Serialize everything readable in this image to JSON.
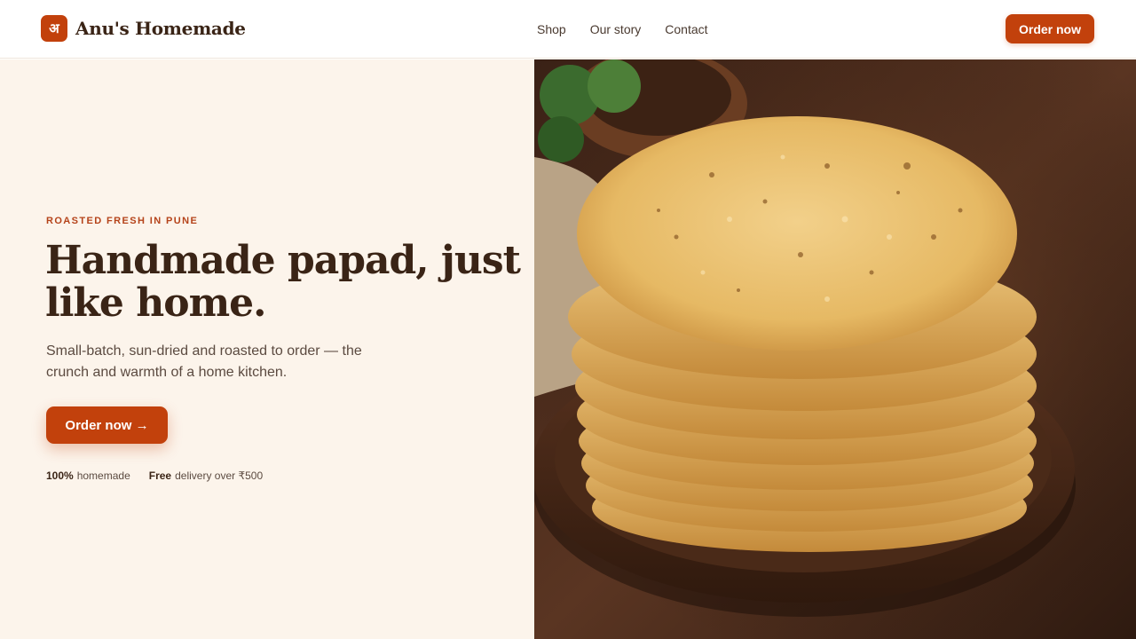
{
  "header": {
    "logo_glyph": "अ",
    "brand": "Anu's Homemade",
    "nav": [
      "Shop",
      "Our story",
      "Contact"
    ],
    "cta": "Order now"
  },
  "hero": {
    "eyebrow": "ROASTED FRESH IN PUNE",
    "headline": "Handmade papad, just like home.",
    "subtext": "Small-batch, sun-dried and roasted to order — the crunch and warmth of a home kitchen.",
    "cta": "Order now →",
    "badges": [
      {
        "strong": "100%",
        "text": "homemade"
      },
      {
        "strong": "Free",
        "text": "delivery over ₹500"
      }
    ]
  },
  "colors": {
    "accent": "#c2410c",
    "hero_bg": "#fcf4eb",
    "text_dark": "#3a2416"
  },
  "image": {
    "subject": "stack of roasted papad on a wooden plate"
  }
}
